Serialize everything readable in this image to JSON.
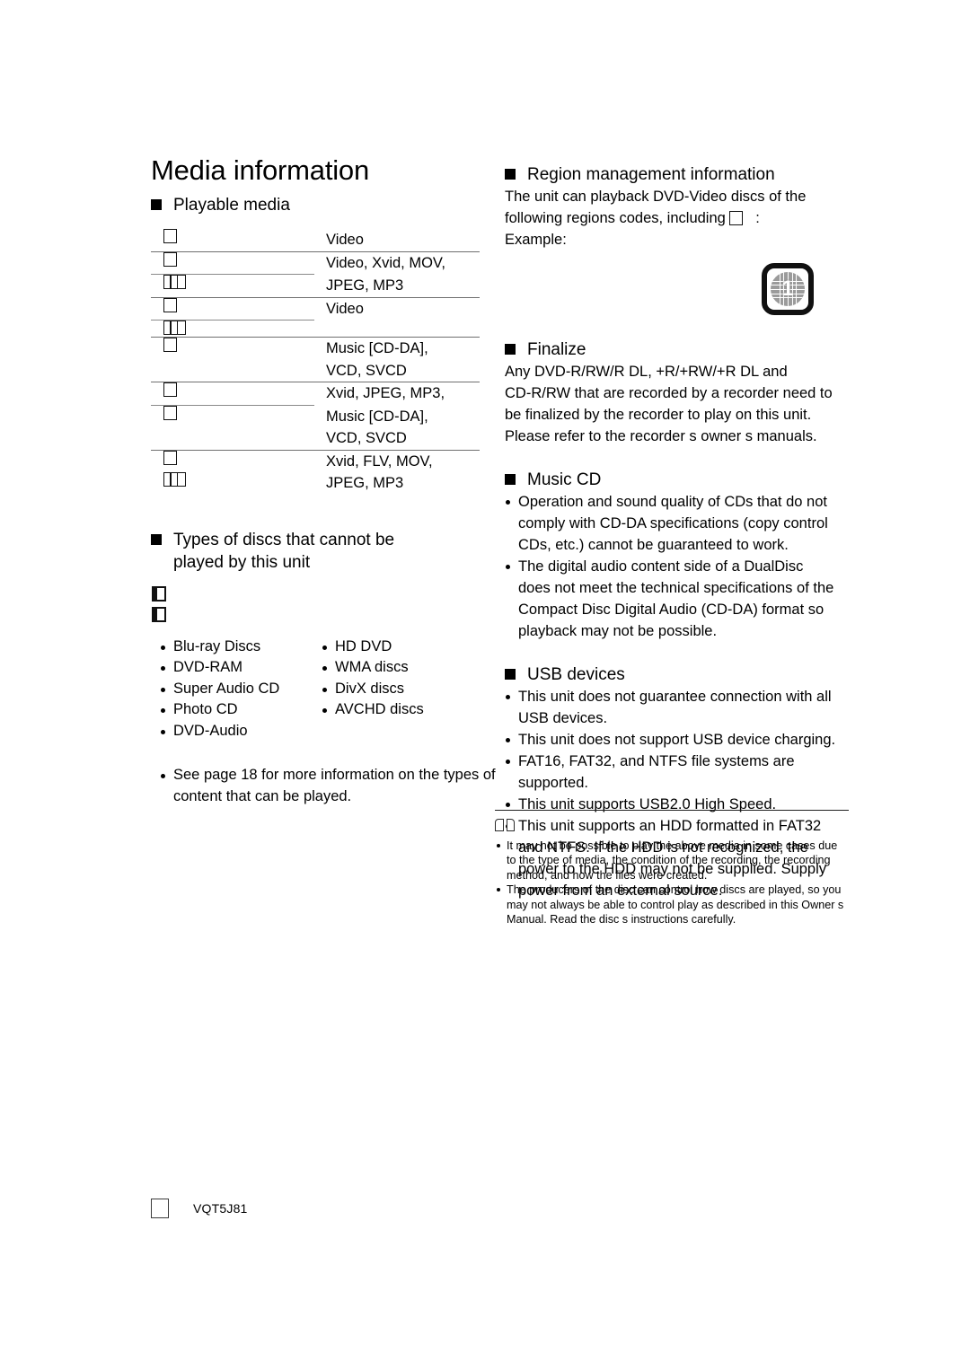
{
  "document": {
    "title": "Media information",
    "footer_code": "VQT5J81"
  },
  "left_column": {
    "playable_media": {
      "heading": "Playable media",
      "rows": [
        {
          "icons": [
            "disc-box"
          ],
          "content": "Video"
        },
        {
          "icons": [
            "disc-box"
          ],
          "content": "Video, Xvid, MOV,"
        },
        {
          "icons": [
            "disc-box-three"
          ],
          "content": "JPEG, MP3"
        },
        {
          "icons": [
            "disc-box"
          ],
          "content": "Video"
        },
        {
          "icons": [
            "disc-box-three"
          ],
          "content": ""
        },
        {
          "icons": [
            "disc-box"
          ],
          "content": "Music [CD-DA],"
        },
        {
          "icons": [],
          "content": "VCD, SVCD"
        },
        {
          "icons": [
            "disc-box"
          ],
          "content": "Xvid, JPEG, MP3,"
        },
        {
          "icons": [
            "disc-box"
          ],
          "content": "Music [CD-DA],"
        },
        {
          "icons": [],
          "content": "VCD, SVCD"
        },
        {
          "icons": [
            "disc-box"
          ],
          "content": "Xvid, FLV, MOV,"
        },
        {
          "icons": [
            "disc-box-three"
          ],
          "content": "JPEG, MP3"
        }
      ]
    },
    "cannot_play": {
      "heading": "Types of discs that cannot be played by this unit",
      "heading_line1": "Types of discs that cannot be",
      "heading_line2": "played by this unit",
      "column_1": [
        "Blu-ray Discs",
        "DVD-RAM",
        "Super Audio CD",
        "Photo CD",
        "DVD-Audio"
      ],
      "column_2": [
        "HD DVD",
        "WMA discs",
        "DivX discs",
        "AVCHD discs"
      ],
      "see_also": "See page 18 for more information on the types of content that can be played."
    }
  },
  "right_column": {
    "region": {
      "heading": "Region management information",
      "body_line1": "The unit can playback DVD-Video discs of the",
      "body_line2_pre": "following regions codes, including",
      "body_line2_post": ":",
      "example_label": "Example:",
      "region_code": "1"
    },
    "finalize": {
      "heading": "Finalize",
      "lines": [
        "Any DVD-R/RW/R DL, +R/+RW/+R DL and",
        "CD-R/RW that are recorded by a recorder need to",
        "be finalized by the recorder to play on this unit.",
        "Please refer to the recorder s owner s manuals."
      ]
    },
    "music_cd": {
      "heading": "Music CD",
      "items": [
        "Operation and sound quality of CDs that do not comply with CD-DA specifications (copy control CDs, etc.) cannot be guaranteed to work.",
        "The digital audio content side of a DualDisc does not meet the technical specifications of the Compact Disc Digital Audio (CD-DA) format so playback may not be possible."
      ]
    },
    "usb_devices": {
      "heading": "USB devices",
      "items": [
        "This unit does not guarantee connection with all USB devices.",
        "This unit does not support USB device charging.",
        "FAT16, FAT32, and NTFS file systems are supported.",
        "This unit supports USB2.0 High Speed.",
        "This unit supports an HDD formatted in FAT32 and NTFS. If the HDD is not recognized, the power to the HDD may not be supplied. Supply power from an external source."
      ]
    }
  },
  "note_box": {
    "icon": "open-book-icon",
    "items": [
      "It may not be possible to play the above media in some cases due to the type of media, the condition of the recording, the recording method, and how the files were created.",
      "The producers of the disc can control how discs are played, so you may not always be able to control play as described in this Owner s Manual. Read the disc s instructions carefully."
    ]
  },
  "colors": {
    "text": "#000000",
    "rule_full": "#6f6f6f",
    "rule_partial": "#8a8a8a",
    "page_background": "#ffffff"
  }
}
